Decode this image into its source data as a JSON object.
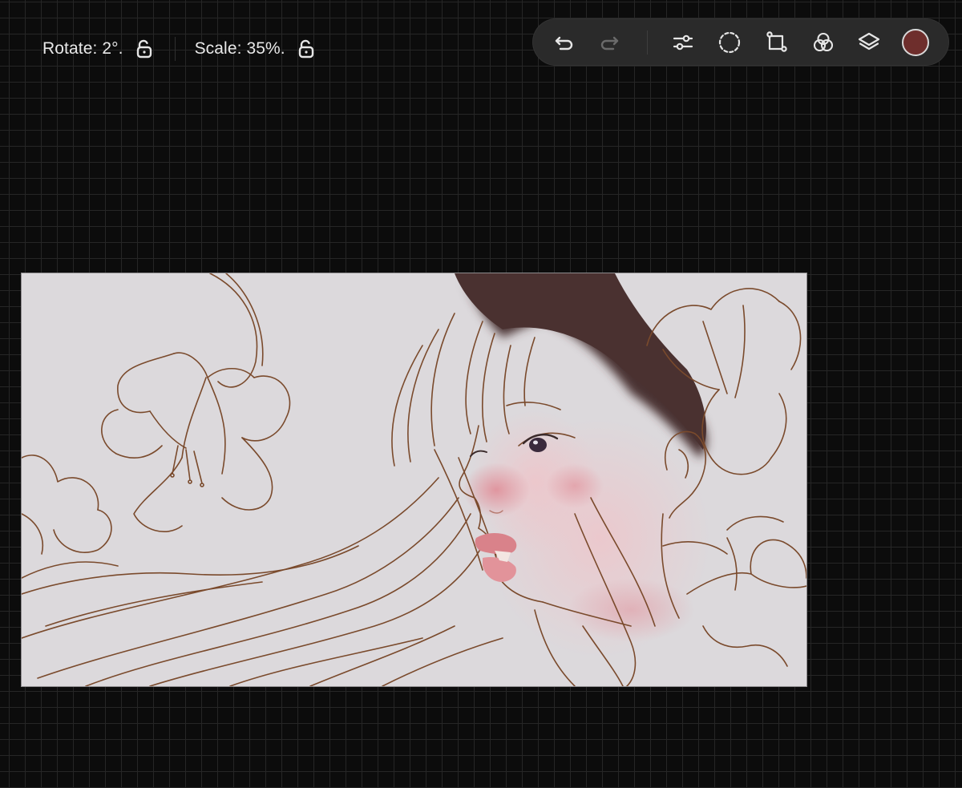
{
  "readout": {
    "rotate_text": "Rotate: 2°.",
    "scale_text": "Scale: 35%."
  },
  "toolbar": {
    "tools": [
      "undo",
      "redo",
      "adjustments",
      "selection",
      "transform",
      "blend",
      "layers"
    ],
    "current_color": "#6e2e2c"
  },
  "colors": {
    "background": "#0c0c0c",
    "grid": "#262626",
    "toolbar_bg": "#2a2a2a",
    "icon": "#e6e6e6",
    "icon_disabled": "#6a6a6a",
    "canvas_bg": "#dcd9dc",
    "line_art": "#7a4a2c",
    "hair": "#4a3130",
    "skin_blush": "#e7a9b0",
    "lips": "#d9828a"
  }
}
